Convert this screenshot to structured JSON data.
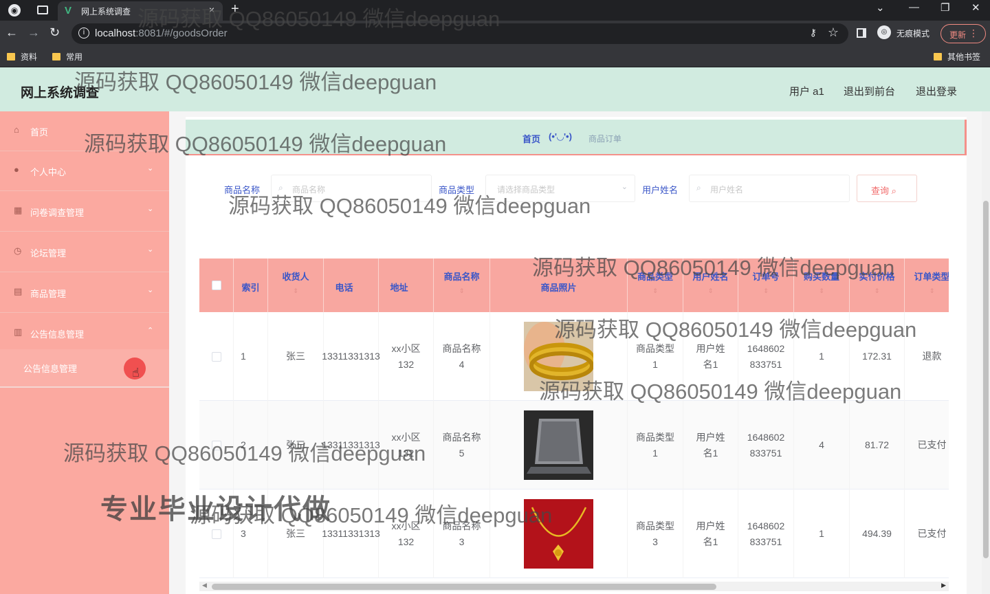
{
  "browser": {
    "tab_title": "网上系统调查",
    "tab_close": "×",
    "new_tab": "+",
    "url_host": "localhost",
    "url_path": ":8081/#/goodsOrder",
    "incognito_label": "无痕模式",
    "update_label": "更新",
    "bookmarks": [
      "资料",
      "常用"
    ],
    "other_bookmarks": "其他书签"
  },
  "header": {
    "title": "网上系统调查",
    "user": "用户 a1",
    "back_to_front": "退出到前台",
    "logout": "退出登录"
  },
  "sidebar": {
    "items": [
      {
        "label": "首页",
        "icon": "home-icon",
        "glyph": "⌂"
      },
      {
        "label": "个人中心",
        "icon": "user-icon",
        "glyph": "●"
      },
      {
        "label": "问卷调查管理",
        "icon": "survey-icon",
        "glyph": "▦"
      },
      {
        "label": "论坛管理",
        "icon": "clock-icon",
        "glyph": "◷"
      },
      {
        "label": "商品管理",
        "icon": "goods-icon",
        "glyph": "▤"
      },
      {
        "label": "公告信息管理",
        "icon": "notice-icon",
        "glyph": "▥"
      }
    ],
    "submenu": "公告信息管理"
  },
  "breadcrumb": {
    "home": "首页",
    "separator": "(•'◡'•)",
    "current": "商品订单"
  },
  "search": {
    "goods_name_label": "商品名称",
    "goods_name_placeholder": "商品名称",
    "goods_type_label": "商品类型",
    "goods_type_placeholder": "请选择商品类型",
    "user_name_label": "用户姓名",
    "user_name_placeholder": "用户姓名",
    "query_label": "查询"
  },
  "table": {
    "columns": [
      "索引",
      "收货人",
      "电话",
      "地址",
      "商品名称",
      "商品照片",
      "商品类型",
      "用户姓名",
      "订单号",
      "购买数量",
      "实付价格",
      "订单类型"
    ],
    "rows": [
      {
        "index": "1",
        "receiver": "张三",
        "phone": "13311331313",
        "address": "xx小区132",
        "goods_name": "商品名称4",
        "photo": "gold-bangles-photo",
        "goods_type": "商品类型1",
        "user_name": "用户姓名1",
        "order_no": "1648602833751",
        "quantity": "1",
        "price": "172.31",
        "order_type": "退款"
      },
      {
        "index": "2",
        "receiver": "张三",
        "phone": "13311331313",
        "address": "xx小区132",
        "goods_name": "商品名称5",
        "photo": "laptop-photo",
        "goods_type": "商品类型1",
        "user_name": "用户姓名1",
        "order_no": "1648602833751",
        "quantity": "4",
        "price": "81.72",
        "order_type": "已支付"
      },
      {
        "index": "3",
        "receiver": "张三",
        "phone": "13311331313",
        "address": "xx小区132",
        "goods_name": "商品名称3",
        "photo": "gold-necklace-photo",
        "goods_type": "商品类型3",
        "user_name": "用户姓名1",
        "order_no": "1648602833751",
        "quantity": "1",
        "price": "494.39",
        "order_type": "已支付"
      }
    ]
  },
  "watermarks": {
    "text": "源码获取 QQ86050149 微信deepguan",
    "promo": "专业毕业设计代做"
  },
  "colors": {
    "header_bg": "#d1ebe0",
    "sidebar_bg": "#fba9a0",
    "table_header_bg": "#f8a7a0",
    "link_blue": "#3a56c8"
  }
}
